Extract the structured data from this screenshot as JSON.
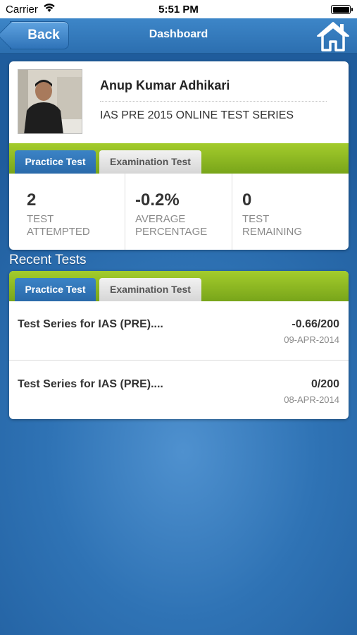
{
  "status_bar": {
    "carrier": "Carrier",
    "time": "5:51 PM"
  },
  "nav": {
    "back_label": "Back",
    "title": "Dashboard",
    "home_icon": "home-icon"
  },
  "profile": {
    "name": "Anup Kumar Adhikari",
    "series": "IAS PRE 2015 ONLINE TEST SERIES"
  },
  "summary_tabs": [
    {
      "label": "Practice Test",
      "active": true
    },
    {
      "label": "Examination Test",
      "active": false
    }
  ],
  "stats": [
    {
      "value": "2",
      "label_line1": "TEST",
      "label_line2": "ATTEMPTED"
    },
    {
      "value": "-0.2%",
      "label_line1": "AVERAGE",
      "label_line2": "PERCENTAGE"
    },
    {
      "value": "0",
      "label_line1": "TEST",
      "label_line2": "REMAINING"
    }
  ],
  "recent": {
    "heading": "Recent Tests",
    "tabs": [
      {
        "label": "Practice Test",
        "active": true
      },
      {
        "label": "Examination Test",
        "active": false
      }
    ],
    "tests": [
      {
        "name": "Test Series for IAS (PRE)....",
        "score": "-0.66/200",
        "date": "09-APR-2014"
      },
      {
        "name": "Test Series for IAS (PRE)....",
        "score": "0/200",
        "date": "08-APR-2014"
      }
    ]
  },
  "colors": {
    "nav_blue": "#2f73b5",
    "tab_green": "#8fba22",
    "active_tab": "#2f73b8"
  }
}
